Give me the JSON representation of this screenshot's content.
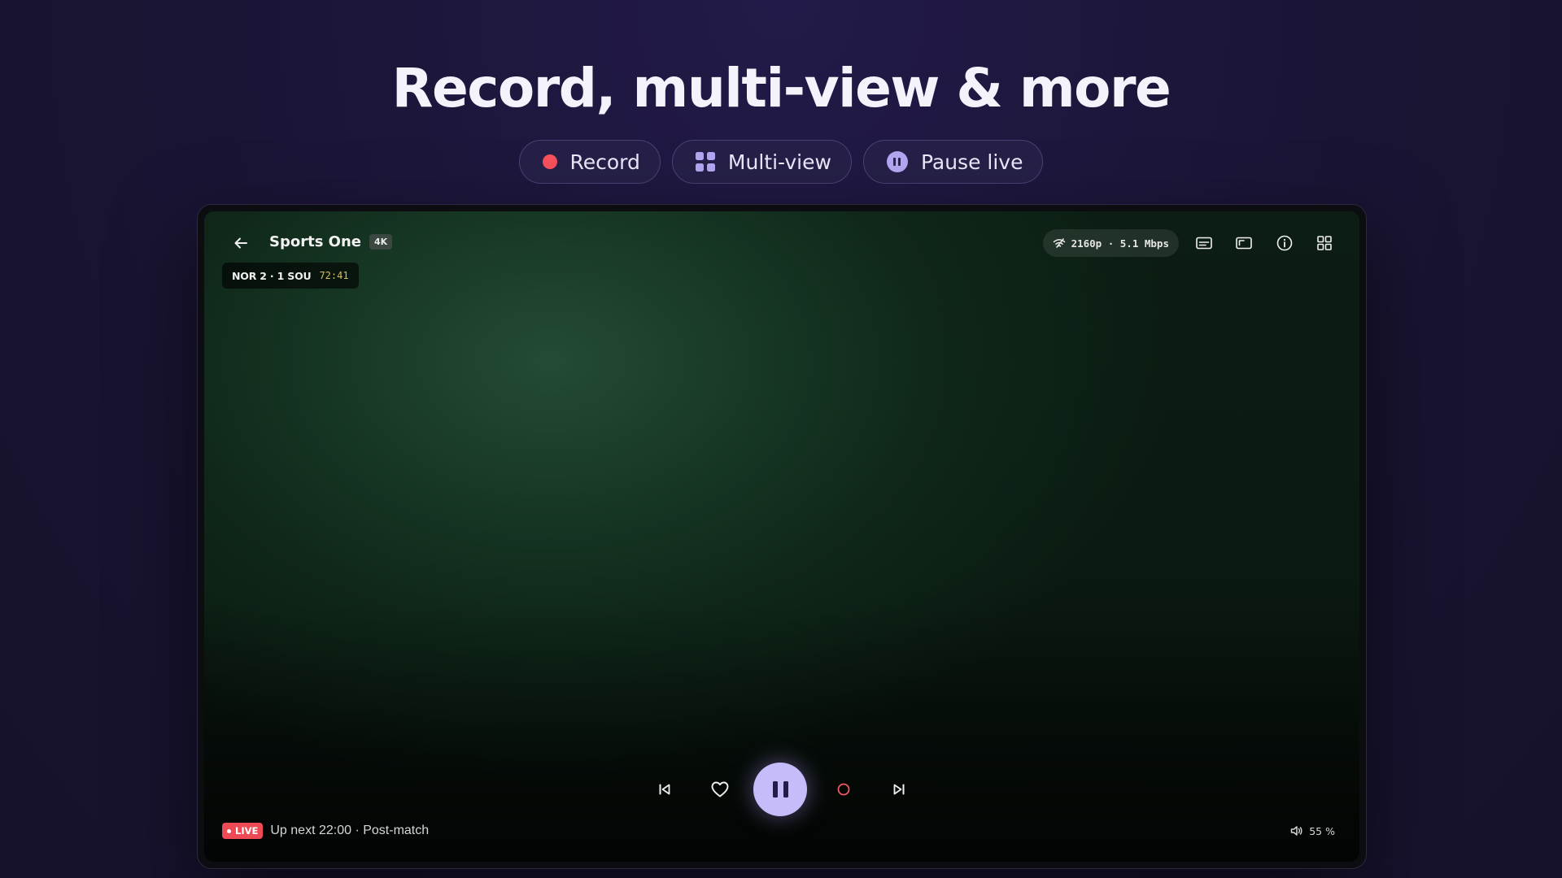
{
  "hero": {
    "title": "Record, multi-view & more",
    "pills": [
      {
        "label": "Record",
        "icon": "record-dot-icon"
      },
      {
        "label": "Multi-view",
        "icon": "grid-icon"
      },
      {
        "label": "Pause live",
        "icon": "pause-circle-icon"
      }
    ]
  },
  "player": {
    "channel": "Sports One",
    "quality_badge": "4K",
    "score": "NOR 2 · 1 SOU",
    "match_clock": "72:41",
    "stream_stats": "2160p · 5.1 Mbps",
    "live_label": "LIVE",
    "up_next": "Up next 22:00 · Post-match",
    "volume": "55 %",
    "icons": {
      "back": "arrow-left-icon",
      "signal": "signal-icon",
      "subtitles": "subtitles-icon",
      "aspect": "aspect-ratio-icon",
      "info": "info-icon",
      "multiview": "grid-icon",
      "previous": "skip-previous-icon",
      "favorite": "heart-icon",
      "play_pause": "pause-icon",
      "record": "record-icon",
      "next": "skip-next-icon",
      "volume": "volume-icon"
    }
  },
  "colors": {
    "background": "#191433",
    "accent": "#c7bcfa",
    "record_red": "#f7515d",
    "live_red": "#ee4a55",
    "clock_gold": "#d8bd5c"
  }
}
